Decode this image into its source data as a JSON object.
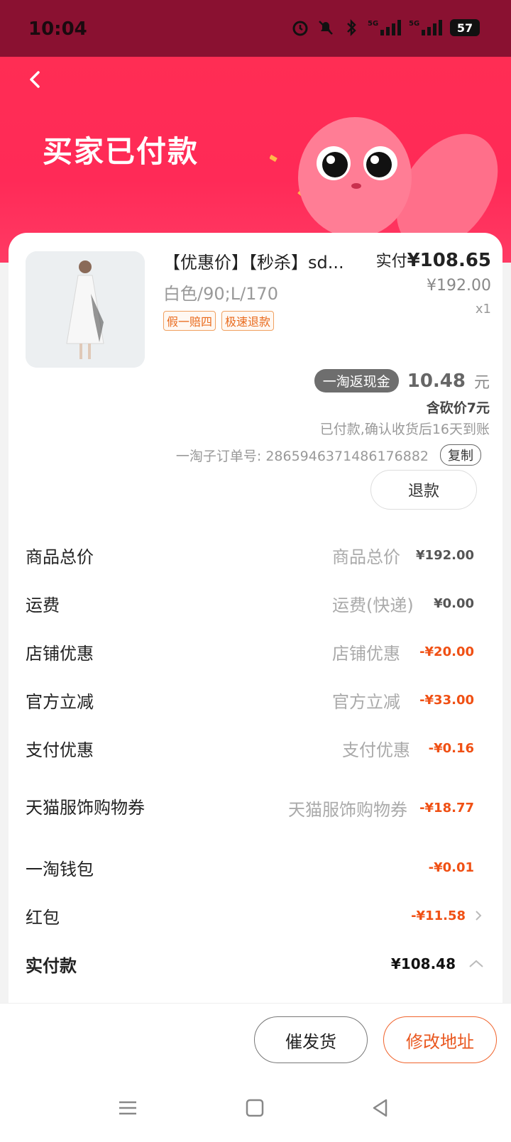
{
  "status_bar": {
    "time": "10:04",
    "signal_1": "5G",
    "signal_2": "5G",
    "battery": "57"
  },
  "header": {
    "title": "买家已付款",
    "icons": [
      "back-arrow-icon",
      "mascot-illustration"
    ]
  },
  "product": {
    "title": "【优惠价】【秒杀】sd...",
    "spec": "白色/90;L/170",
    "tags": [
      "假一赔四",
      "极速退款"
    ],
    "paid_label": "实付",
    "paid_amount": "¥108.65",
    "original_price": "¥192.00",
    "quantity": "x1"
  },
  "cashback": {
    "pill": "一淘返现金",
    "amount": "10.48",
    "unit": "元",
    "bargain": "含砍价7元",
    "note": "已付款,确认收货后16天到账"
  },
  "order": {
    "number_text": "一淘子订单号: 2865946371486176882",
    "copy_label": "复制",
    "refund_label": "退款"
  },
  "summary_rows": [
    {
      "label": "商品总价",
      "mid": "商品总价",
      "amount": "¥192.00",
      "red": false
    },
    {
      "label": "运费",
      "mid": "运费(快递)",
      "amount": "¥0.00",
      "red": false
    },
    {
      "label": "店铺优惠",
      "mid": "店铺优惠",
      "amount": "-¥20.00",
      "red": true
    },
    {
      "label": "官方立减",
      "mid": "官方立减",
      "amount": "-¥33.00",
      "red": true
    },
    {
      "label": "支付优惠",
      "mid": "支付优惠",
      "amount": "-¥0.16",
      "red": true
    },
    {
      "label": "天猫服饰购物券",
      "mid": "天猫服饰购物券",
      "amount": "-¥18.77",
      "red": true
    },
    {
      "label": "一淘钱包",
      "mid": "",
      "amount": "-¥0.01",
      "red": true
    },
    {
      "label": "红包",
      "mid": "",
      "amount": "-¥11.58",
      "red": true
    }
  ],
  "total": {
    "label": "实付款",
    "amount": "¥108.48"
  },
  "actions": {
    "urge_label": "催发货",
    "address_label": "修改地址"
  },
  "colors": {
    "header_red": "#ff2d54",
    "status_bar": "#8a1131",
    "accent_orange": "#f05014"
  },
  "nav": {
    "icons": [
      "menu-icon",
      "home-icon",
      "back-icon"
    ]
  }
}
